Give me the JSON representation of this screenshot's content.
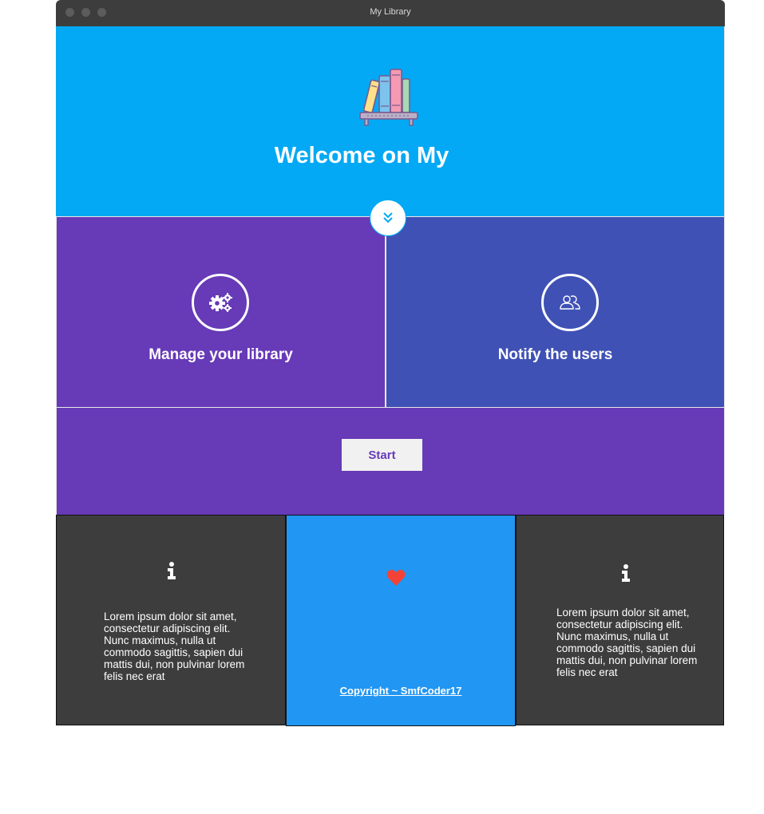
{
  "window": {
    "title": "My Library"
  },
  "hero": {
    "title": "Welcome on My",
    "logo_icon": "bookshelf-icon",
    "scroll_icon": "double-chevron-down-icon"
  },
  "features": [
    {
      "label": "Manage your library",
      "icon": "gears-icon"
    },
    {
      "label": "Notify the users",
      "icon": "users-icon"
    }
  ],
  "start": {
    "label": "Start"
  },
  "footer": {
    "left_text": "Lorem ipsum dolor sit amet, consectetur adipiscing elit. Nunc maximus, nulla ut commodo sagittis, sapien dui mattis dui, non pulvinar lorem felis nec erat",
    "center_icon": "heart-icon",
    "copyright": "Copyright ~ SmfCoder17",
    "right_text": "Lorem ipsum dolor sit amet, consectetur adipiscing elit. Nunc maximus, nulla ut commodo sagittis, sapien dui mattis dui, non pulvinar lorem felis nec erat"
  },
  "colors": {
    "hero": "#03a9f4",
    "manage": "#673ab7",
    "notify": "#3f51b5",
    "footer_dark": "#3d3d3d",
    "footer_blue": "#2196f3",
    "heart": "#f44336"
  }
}
